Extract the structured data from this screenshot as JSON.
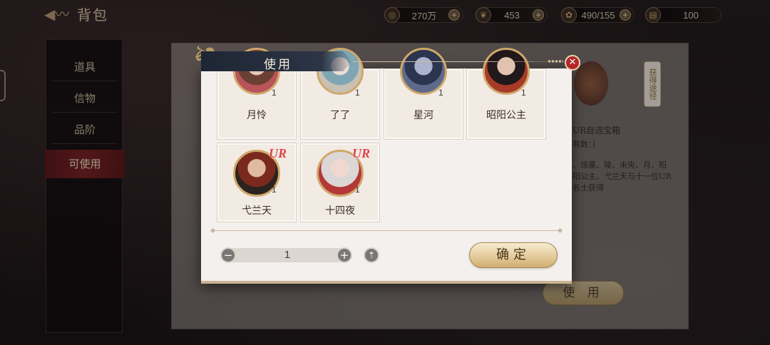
{
  "header": {
    "title": "背包",
    "resources": [
      {
        "icon": "coin-icon",
        "glyph": "◎",
        "value": "270万"
      },
      {
        "icon": "feather-icon",
        "glyph": "❦",
        "value": "453"
      },
      {
        "icon": "flower-icon",
        "glyph": "✿",
        "value": "490/155"
      },
      {
        "icon": "scroll-icon",
        "glyph": "▤",
        "value": "100"
      }
    ]
  },
  "sidebar": {
    "items": [
      {
        "label": "道具"
      },
      {
        "label": "信物"
      },
      {
        "label": "品阶"
      },
      {
        "label": "可使用",
        "active": true
      }
    ]
  },
  "background_panel": {
    "item_name": "UR自选宝箱",
    "owned_text": "有数：)",
    "description": "、惊墨、陵、未央、月、昭阳公主、弋兰天与十一位UR名士获得",
    "get_path_label": "获得途径",
    "use_button_label": "使 用"
  },
  "dialog": {
    "title": "使用",
    "cards": [
      {
        "name": "月怜",
        "count": "1",
        "ur": false,
        "colors": [
          "#6a4034",
          "#e6c7b8",
          "#b8545a"
        ]
      },
      {
        "name": "了了",
        "count": "1",
        "ur": false,
        "colors": [
          "#7fa6b3",
          "#eadfd8",
          "#c9c0b4"
        ]
      },
      {
        "name": "星河",
        "count": "1",
        "ur": false,
        "colors": [
          "#2c3550",
          "#a9b4cc",
          "#5e6a8c"
        ]
      },
      {
        "name": "昭阳公主",
        "count": "1",
        "ur": false,
        "colors": [
          "#20181a",
          "#e0c2ae",
          "#a83a2a"
        ]
      },
      {
        "name": "弋兰天",
        "count": "1",
        "ur": true,
        "ur_label": "UR",
        "colors": [
          "#7a2a1c",
          "#e0b9a0",
          "#2a2320"
        ]
      },
      {
        "name": "十四夜",
        "count": "1",
        "ur": true,
        "ur_label": "UR",
        "colors": [
          "#ddd6d6",
          "#f0d8cf",
          "#b43838"
        ]
      }
    ],
    "quantity": "1",
    "confirm_label": "确定"
  },
  "colors": {
    "accent_red": "#b3262a",
    "gold": "#cfa86a",
    "dialog_bg": "#f4f0ee",
    "ur_red": "#d94646"
  }
}
